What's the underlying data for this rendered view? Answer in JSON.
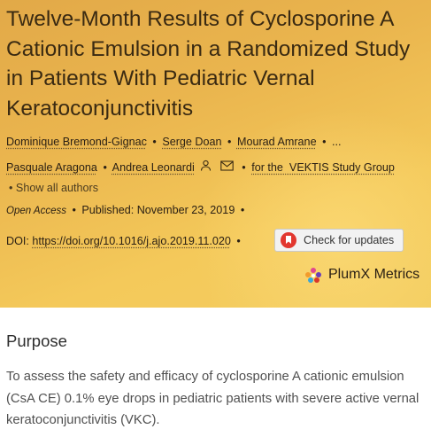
{
  "article": {
    "title": "Twelve-Month Results of Cyclosporine A Cationic Emulsion in a Randomized Study in Patients With Pediatric Vernal Keratoconjunctivitis",
    "authors_line1": [
      "Dominique Bremond-Gignac",
      "Serge Doan",
      "Mourad Amrane",
      "..."
    ],
    "authors_line2": [
      "Pasquale Aragona",
      "Andrea Leonardi"
    ],
    "study_group": "for the  VEKTIS Study Group",
    "show_all": "Show all authors",
    "open_access": "Open Access",
    "published_label": "Published:",
    "published_date": "November 23, 2019",
    "doi_label": "DOI:",
    "doi_link": "https://doi.org/10.1016/j.ajo.2019.11.020",
    "check_updates": "Check for updates",
    "plumx": "PlumX Metrics",
    "dot": "•"
  },
  "section": {
    "title": "Purpose",
    "text": "To assess the safety and efficacy of cyclosporine A cationic emulsion (CsA CE) 0.1% eye drops in pediatric patients with severe active vernal keratoconjunctivitis (VKC)."
  },
  "icons": [
    "person-icon",
    "mail-icon",
    "crossmark-icon",
    "plumx-icon"
  ],
  "colors": {
    "hero_start": "#e2a948",
    "hero_end": "#f3cd60",
    "crossmark_red": "#e2372f"
  }
}
